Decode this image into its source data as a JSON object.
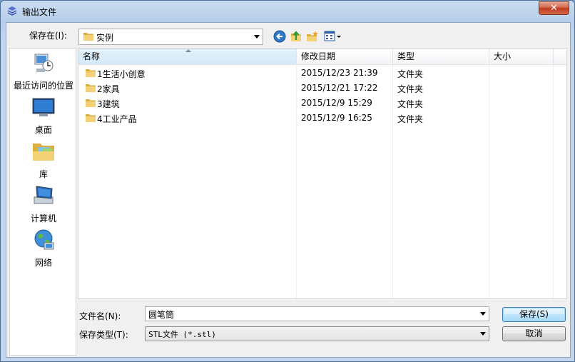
{
  "window": {
    "title": "输出文件",
    "close_label": "✕"
  },
  "top": {
    "save_in_label": "保存在(I):",
    "save_in_value": "实例"
  },
  "places": [
    {
      "id": "recent",
      "label": "最近访问的位置"
    },
    {
      "id": "desktop",
      "label": "桌面"
    },
    {
      "id": "library",
      "label": "库"
    },
    {
      "id": "computer",
      "label": "计算机"
    },
    {
      "id": "network",
      "label": "网络"
    }
  ],
  "columns": {
    "name": "名称",
    "modified": "修改日期",
    "type": "类型",
    "size": "大小"
  },
  "files": [
    {
      "name": "1生活小创意",
      "modified": "2015/12/23 21:39",
      "type": "文件夹",
      "size": ""
    },
    {
      "name": "2家具",
      "modified": "2015/12/21 17:22",
      "type": "文件夹",
      "size": ""
    },
    {
      "name": "3建筑",
      "modified": "2015/12/9 15:29",
      "type": "文件夹",
      "size": ""
    },
    {
      "name": "4工业产品",
      "modified": "2015/12/9 16:25",
      "type": "文件夹",
      "size": ""
    }
  ],
  "bottom": {
    "filename_label": "文件名(N):",
    "filename_value": "圆笔筒",
    "filetype_label": "保存类型(T):",
    "filetype_value": "STL文件 (*.stl)",
    "save_button": "保存(S)",
    "cancel_button": "取消"
  },
  "colors": {
    "accent": "#3c7fb1",
    "folder": "#e8c25a",
    "close": "#c1391c"
  }
}
